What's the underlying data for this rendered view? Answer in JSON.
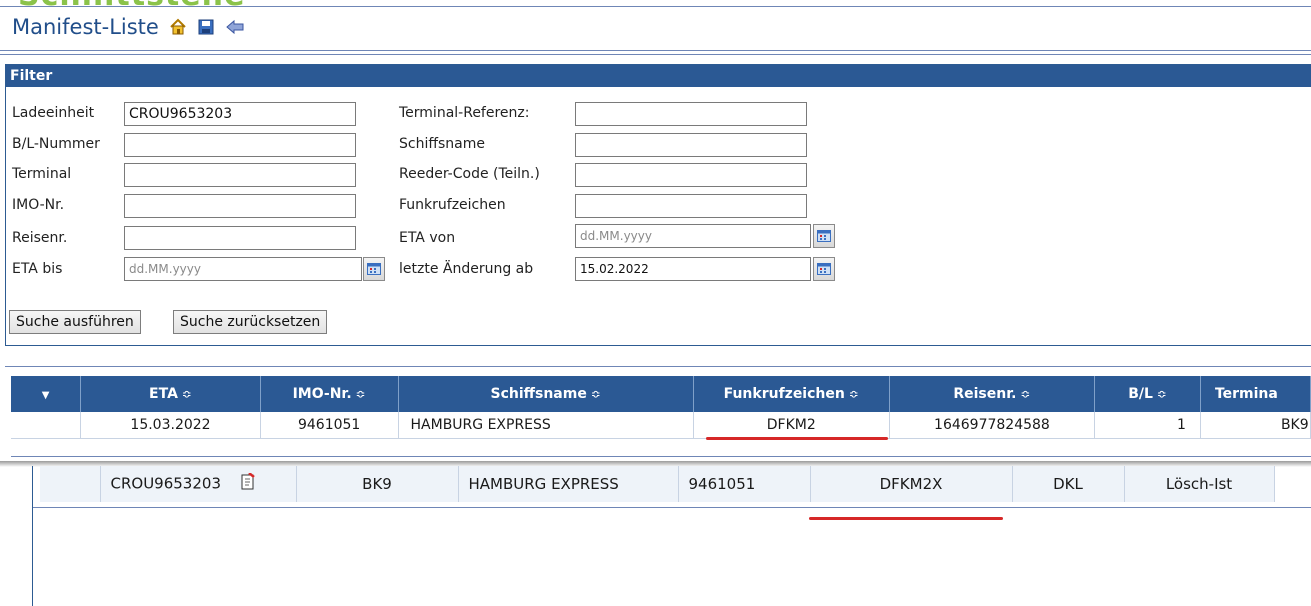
{
  "logo_fragment": "Schnittstelle",
  "header": {
    "title": "Manifest-Liste",
    "icons": [
      "home-icon",
      "save-icon",
      "back-arrow-icon"
    ]
  },
  "filter": {
    "title": "Filter",
    "fields": {
      "ladeeinheit": {
        "label": "Ladeeinheit",
        "value": "CROU9653203"
      },
      "bl_nummer": {
        "label": "B/L-Nummer",
        "value": ""
      },
      "terminal": {
        "label": "Terminal",
        "value": ""
      },
      "imo_nr": {
        "label": "IMO-Nr.",
        "value": ""
      },
      "reisenr": {
        "label": "Reisenr.",
        "value": ""
      },
      "eta_bis": {
        "label": "ETA bis",
        "placeholder": "dd.MM.yyyy",
        "value": ""
      },
      "terminal_referenz": {
        "label": "Terminal-Referenz:",
        "value": ""
      },
      "schiffsname": {
        "label": "Schiffsname",
        "value": ""
      },
      "reeder_code": {
        "label": "Reeder-Code (Teiln.)",
        "value": ""
      },
      "funkrufzeichen": {
        "label": "Funkrufzeichen",
        "value": ""
      },
      "eta_von": {
        "label": "ETA von",
        "placeholder": "dd.MM.yyyy",
        "value": ""
      },
      "letzte_aenderung": {
        "label": "letzte Änderung ab",
        "value": "15.02.2022"
      }
    },
    "buttons": {
      "search": "Suche ausführen",
      "reset": "Suche zurücksetzen"
    }
  },
  "grid": {
    "columns": [
      "",
      "ETA",
      "IMO-Nr.",
      "Schiffsname",
      "Funkrufzeichen",
      "Reisenr.",
      "B/L",
      "Termina"
    ],
    "sort_glyph": "≎",
    "rows": [
      {
        "eta": "15.03.2022",
        "imo": "9461051",
        "schiffsname": "HAMBURG EXPRESS",
        "funkrufzeichen": "DFKM2",
        "reisenr": "1646977824588",
        "bl": "1",
        "terminal": "BK9"
      }
    ]
  },
  "lower_grid": {
    "rows": [
      {
        "ladeeinheit": "CROU9653203",
        "terminal": "BK9",
        "schiffsname": "HAMBURG EXPRESS",
        "imo": "9461051",
        "funkrufzeichen": "DFKM2X",
        "code": "DKL",
        "status": "Lösch-Ist"
      }
    ]
  },
  "colors": {
    "header_blue": "#2b5994",
    "title_blue": "#214e8a",
    "highlight_red": "#d62828",
    "logo_green": "#8bc34a"
  }
}
